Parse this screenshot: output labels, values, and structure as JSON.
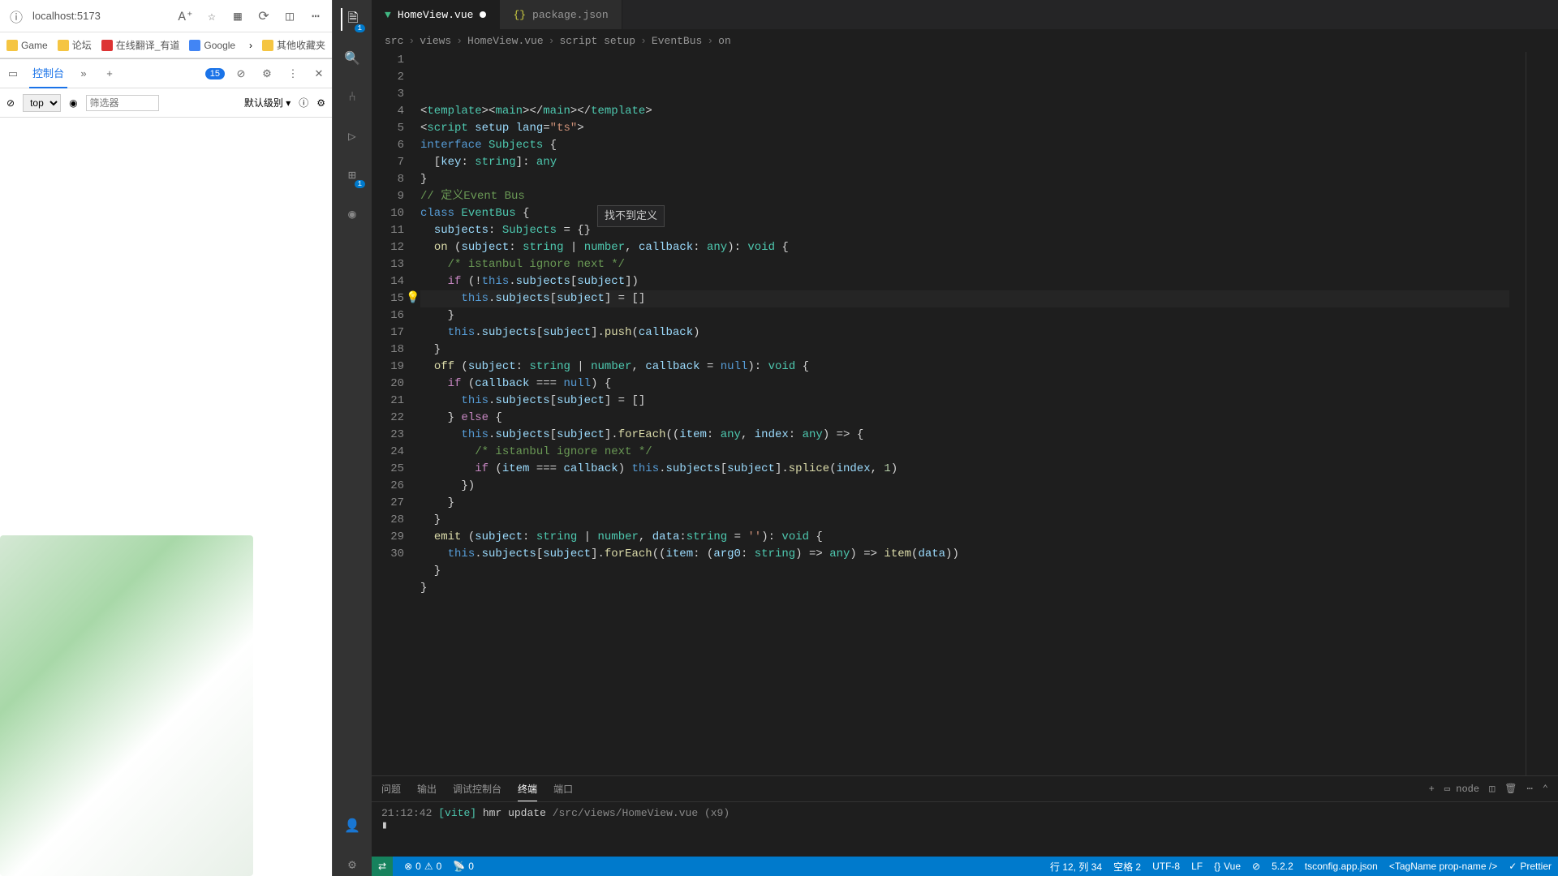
{
  "browser": {
    "url": "localhost:5173",
    "bookmarks": [
      {
        "label": "Game",
        "color": "#f5c542"
      },
      {
        "label": "论坛",
        "color": "#f5c542"
      },
      {
        "label": "在线翻译_有道",
        "color": "#d33"
      },
      {
        "label": "Google",
        "color": "#4285f4"
      },
      {
        "label": "其他收藏夹",
        "color": "#f5c542"
      }
    ]
  },
  "devtools": {
    "console_tab": "控制台",
    "issue_count": "15",
    "context": "top",
    "filter_placeholder": "筛选器",
    "level": "默认级别"
  },
  "vscode": {
    "tabs": [
      {
        "name": "HomeView.vue",
        "icon": "vue",
        "active": true,
        "dirty": true
      },
      {
        "name": "package.json",
        "icon": "json",
        "active": false,
        "dirty": false
      }
    ],
    "breadcrumb": [
      "src",
      "views",
      "HomeView.vue",
      "script setup",
      "EventBus",
      "on"
    ],
    "hover_tip": "找不到定义",
    "code": [
      {
        "n": 1,
        "tokens": [
          [
            "pun",
            "<"
          ],
          [
            "tag",
            "template"
          ],
          [
            "pun",
            "><"
          ],
          [
            "tag",
            "main"
          ],
          [
            "pun",
            "></"
          ],
          [
            "tag",
            "main"
          ],
          [
            "pun",
            "></"
          ],
          [
            "tag",
            "template"
          ],
          [
            "pun",
            ">"
          ]
        ]
      },
      {
        "n": 2,
        "tokens": [
          [
            "pun",
            "<"
          ],
          [
            "tag",
            "script"
          ],
          [
            "pun",
            " "
          ],
          [
            "var",
            "setup"
          ],
          [
            "pun",
            " "
          ],
          [
            "var",
            "lang"
          ],
          [
            "pun",
            "="
          ],
          [
            "str",
            "\"ts\""
          ],
          [
            "pun",
            ">"
          ]
        ]
      },
      {
        "n": 3,
        "tokens": [
          [
            "kw",
            "interface"
          ],
          [
            "pun",
            " "
          ],
          [
            "type",
            "Subjects"
          ],
          [
            "pun",
            " {"
          ]
        ]
      },
      {
        "n": 4,
        "tokens": [
          [
            "pun",
            "  ["
          ],
          [
            "var",
            "key"
          ],
          [
            "pun",
            ": "
          ],
          [
            "type",
            "string"
          ],
          [
            "pun",
            "]: "
          ],
          [
            "type",
            "any"
          ]
        ]
      },
      {
        "n": 5,
        "tokens": [
          [
            "pun",
            "}"
          ]
        ]
      },
      {
        "n": 6,
        "tokens": [
          [
            "cmt",
            "// 定义Event Bus"
          ]
        ]
      },
      {
        "n": 7,
        "tokens": [
          [
            "kw",
            "class"
          ],
          [
            "pun",
            " "
          ],
          [
            "type",
            "EventBus"
          ],
          [
            "pun",
            " {"
          ]
        ]
      },
      {
        "n": 8,
        "tokens": [
          [
            "pun",
            "  "
          ],
          [
            "var",
            "subjects"
          ],
          [
            "pun",
            ": "
          ],
          [
            "type",
            "Subjects"
          ],
          [
            "pun",
            " = {}"
          ]
        ]
      },
      {
        "n": 9,
        "tokens": [
          [
            "pun",
            "  "
          ],
          [
            "fn",
            "on"
          ],
          [
            "pun",
            " ("
          ],
          [
            "var",
            "subject"
          ],
          [
            "pun",
            ": "
          ],
          [
            "type",
            "string"
          ],
          [
            "pun",
            " | "
          ],
          [
            "type",
            "number"
          ],
          [
            "pun",
            ", "
          ],
          [
            "var",
            "callback"
          ],
          [
            "pun",
            ": "
          ],
          [
            "type",
            "any"
          ],
          [
            "pun",
            "): "
          ],
          [
            "type",
            "void"
          ],
          [
            "pun",
            " {"
          ]
        ]
      },
      {
        "n": 10,
        "tokens": [
          [
            "pun",
            "    "
          ],
          [
            "cmt",
            "/* istanbul ignore next */"
          ]
        ]
      },
      {
        "n": 11,
        "tokens": [
          [
            "pun",
            "    "
          ],
          [
            "kw2",
            "if"
          ],
          [
            "pun",
            " (!"
          ],
          [
            "kw",
            "this"
          ],
          [
            "pun",
            "."
          ],
          [
            "var",
            "subjects"
          ],
          [
            "pun",
            "["
          ],
          [
            "var",
            "subject"
          ],
          [
            "pun",
            "])"
          ]
        ]
      },
      {
        "n": 12,
        "hl": true,
        "bulb": true,
        "tokens": [
          [
            "pun",
            "      "
          ],
          [
            "kw",
            "this"
          ],
          [
            "pun",
            "."
          ],
          [
            "var",
            "subjects"
          ],
          [
            "pun",
            "["
          ],
          [
            "var",
            "subject"
          ],
          [
            "pun",
            "] = []"
          ]
        ]
      },
      {
        "n": 13,
        "tokens": [
          [
            "pun",
            "    }"
          ]
        ]
      },
      {
        "n": 14,
        "tokens": [
          [
            "pun",
            "    "
          ],
          [
            "kw",
            "this"
          ],
          [
            "pun",
            "."
          ],
          [
            "var",
            "subjects"
          ],
          [
            "pun",
            "["
          ],
          [
            "var",
            "subject"
          ],
          [
            "pun",
            "]."
          ],
          [
            "fn",
            "push"
          ],
          [
            "pun",
            "("
          ],
          [
            "var",
            "callback"
          ],
          [
            "pun",
            ")"
          ]
        ]
      },
      {
        "n": 15,
        "tokens": [
          [
            "pun",
            "  }"
          ]
        ]
      },
      {
        "n": 16,
        "tokens": [
          [
            "pun",
            "  "
          ],
          [
            "fn",
            "off"
          ],
          [
            "pun",
            " ("
          ],
          [
            "var",
            "subject"
          ],
          [
            "pun",
            ": "
          ],
          [
            "type",
            "string"
          ],
          [
            "pun",
            " | "
          ],
          [
            "type",
            "number"
          ],
          [
            "pun",
            ", "
          ],
          [
            "var",
            "callback"
          ],
          [
            "pun",
            " = "
          ],
          [
            "kw",
            "null"
          ],
          [
            "pun",
            "): "
          ],
          [
            "type",
            "void"
          ],
          [
            "pun",
            " {"
          ]
        ]
      },
      {
        "n": 17,
        "tokens": [
          [
            "pun",
            "    "
          ],
          [
            "kw2",
            "if"
          ],
          [
            "pun",
            " ("
          ],
          [
            "var",
            "callback"
          ],
          [
            "pun",
            " === "
          ],
          [
            "kw",
            "null"
          ],
          [
            "pun",
            ") {"
          ]
        ]
      },
      {
        "n": 18,
        "tokens": [
          [
            "pun",
            "      "
          ],
          [
            "kw",
            "this"
          ],
          [
            "pun",
            "."
          ],
          [
            "var",
            "subjects"
          ],
          [
            "pun",
            "["
          ],
          [
            "var",
            "subject"
          ],
          [
            "pun",
            "] = []"
          ]
        ]
      },
      {
        "n": 19,
        "tokens": [
          [
            "pun",
            "    } "
          ],
          [
            "kw2",
            "else"
          ],
          [
            "pun",
            " {"
          ]
        ]
      },
      {
        "n": 20,
        "tokens": [
          [
            "pun",
            "      "
          ],
          [
            "kw",
            "this"
          ],
          [
            "pun",
            "."
          ],
          [
            "var",
            "subjects"
          ],
          [
            "pun",
            "["
          ],
          [
            "var",
            "subject"
          ],
          [
            "pun",
            "]."
          ],
          [
            "fn",
            "forEach"
          ],
          [
            "pun",
            "(("
          ],
          [
            "var",
            "item"
          ],
          [
            "pun",
            ": "
          ],
          [
            "type",
            "any"
          ],
          [
            "pun",
            ", "
          ],
          [
            "var",
            "index"
          ],
          [
            "pun",
            ": "
          ],
          [
            "type",
            "any"
          ],
          [
            "pun",
            ") => {"
          ]
        ]
      },
      {
        "n": 21,
        "tokens": [
          [
            "pun",
            "        "
          ],
          [
            "cmt",
            "/* istanbul ignore next */"
          ]
        ]
      },
      {
        "n": 22,
        "tokens": [
          [
            "pun",
            "        "
          ],
          [
            "kw2",
            "if"
          ],
          [
            "pun",
            " ("
          ],
          [
            "var",
            "item"
          ],
          [
            "pun",
            " === "
          ],
          [
            "var",
            "callback"
          ],
          [
            "pun",
            ") "
          ],
          [
            "kw",
            "this"
          ],
          [
            "pun",
            "."
          ],
          [
            "var",
            "subjects"
          ],
          [
            "pun",
            "["
          ],
          [
            "var",
            "subject"
          ],
          [
            "pun",
            "]."
          ],
          [
            "fn",
            "splice"
          ],
          [
            "pun",
            "("
          ],
          [
            "var",
            "index"
          ],
          [
            "pun",
            ", "
          ],
          [
            "num",
            "1"
          ],
          [
            "pun",
            ")"
          ]
        ]
      },
      {
        "n": 23,
        "tokens": [
          [
            "pun",
            "      })"
          ]
        ]
      },
      {
        "n": 24,
        "tokens": [
          [
            "pun",
            "    }"
          ]
        ]
      },
      {
        "n": 25,
        "tokens": [
          [
            "pun",
            "  }"
          ]
        ]
      },
      {
        "n": 26,
        "tokens": [
          [
            "pun",
            "  "
          ],
          [
            "fn",
            "emit"
          ],
          [
            "pun",
            " ("
          ],
          [
            "var",
            "subject"
          ],
          [
            "pun",
            ": "
          ],
          [
            "type",
            "string"
          ],
          [
            "pun",
            " | "
          ],
          [
            "type",
            "number"
          ],
          [
            "pun",
            ", "
          ],
          [
            "var",
            "data"
          ],
          [
            "pun",
            ":"
          ],
          [
            "type",
            "string"
          ],
          [
            "pun",
            " = "
          ],
          [
            "str",
            "''"
          ],
          [
            "pun",
            "): "
          ],
          [
            "type",
            "void"
          ],
          [
            "pun",
            " {"
          ]
        ]
      },
      {
        "n": 27,
        "tokens": [
          [
            "pun",
            "    "
          ],
          [
            "kw",
            "this"
          ],
          [
            "pun",
            "."
          ],
          [
            "var",
            "subjects"
          ],
          [
            "pun",
            "["
          ],
          [
            "var",
            "subject"
          ],
          [
            "pun",
            "]."
          ],
          [
            "fn",
            "forEach"
          ],
          [
            "pun",
            "(("
          ],
          [
            "var",
            "item"
          ],
          [
            "pun",
            ": ("
          ],
          [
            "var",
            "arg0"
          ],
          [
            "pun",
            ": "
          ],
          [
            "type",
            "string"
          ],
          [
            "pun",
            ") => "
          ],
          [
            "type",
            "any"
          ],
          [
            "pun",
            ") => "
          ],
          [
            "fn",
            "item"
          ],
          [
            "pun",
            "("
          ],
          [
            "var",
            "data"
          ],
          [
            "pun",
            "))"
          ]
        ]
      },
      {
        "n": 28,
        "tokens": [
          [
            "pun",
            "  }"
          ]
        ]
      },
      {
        "n": 29,
        "tokens": [
          [
            "pun",
            "}"
          ]
        ]
      },
      {
        "n": 30,
        "tokens": [
          [
            "pun",
            ""
          ]
        ]
      }
    ],
    "terminal": {
      "tabs": [
        "问题",
        "输出",
        "调试控制台",
        "终端",
        "端口"
      ],
      "active_tab": "终端",
      "shell": "node",
      "line_time": "21:12:42",
      "line_vite": "[vite]",
      "line_msg": "hmr update",
      "line_path": "/src/views/HomeView.vue",
      "line_count": "(x9)",
      "cursor": "▮"
    },
    "statusbar": {
      "errors": "0",
      "warnings": "0",
      "ports": "0",
      "position": "行 12, 列 34",
      "spaces": "空格 2",
      "encoding": "UTF-8",
      "eol": "LF",
      "lang": "Vue",
      "version": "5.2.2",
      "tsconfig": "tsconfig.app.json",
      "tagname": "<TagName prop-name />",
      "prettier": "Prettier"
    },
    "activity_badge_explorer": "1",
    "activity_badge_ext": "1"
  }
}
